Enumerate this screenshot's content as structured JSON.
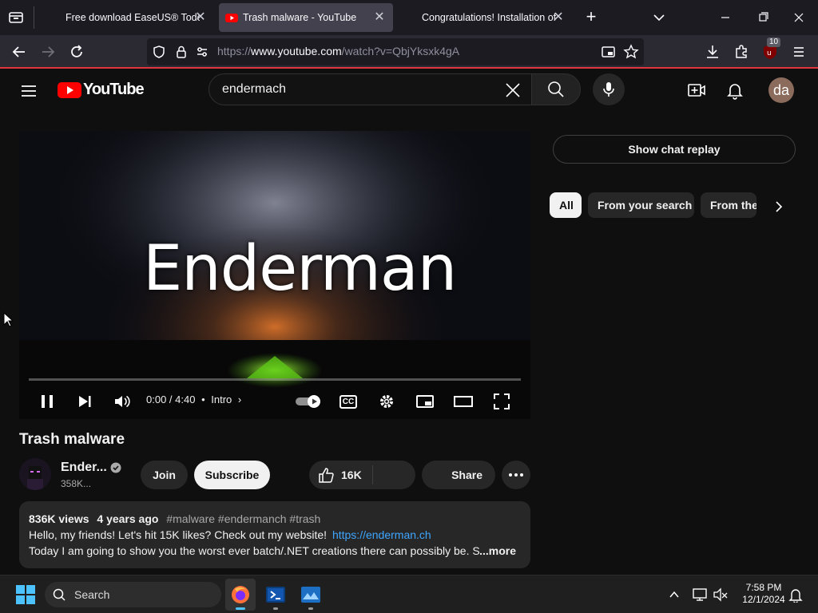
{
  "browser": {
    "tabs": [
      {
        "title": "Free download EaseUS® Todo Ba",
        "active": false
      },
      {
        "title": "Trash malware - YouTube",
        "active": true
      },
      {
        "title": "Congratulations! Installation of",
        "active": false
      }
    ],
    "new_tab_label": "+",
    "url_prefix": "https://",
    "url_host": "www.youtube.com",
    "url_path": "/watch?v=QbjYksxk4gA",
    "extension_badge": "10"
  },
  "youtube": {
    "logo_text": "YouTube",
    "search_value": "endermach",
    "avatar_initials": "da",
    "video": {
      "overlay_text": "Enderman",
      "time": "0:00 / 4:40",
      "chapter": "Intro",
      "cc_label": "CC",
      "progress": 0.0
    },
    "title": "Trash malware",
    "channel_name": "Ender...",
    "subscribers": "358K...",
    "join_label": "Join",
    "subscribe_label": "Subscribe",
    "likes": "16K",
    "share_label": "Share",
    "description": {
      "views": "836K views",
      "age": "4 years ago",
      "tags": "#malware #endermanch #trash",
      "line1": "Hello, my friends! Let's hit 15K likes? Check out my website!",
      "link": "https://enderman.ch",
      "line2": "Today I am going to show you the worst ever batch/.NET creations there can possibly be. S",
      "more": "...more"
    },
    "chat_replay_label": "Show chat replay",
    "chips": [
      "All",
      "From your search",
      "From the"
    ]
  },
  "taskbar": {
    "search_placeholder": "Search",
    "time": "7:58 PM",
    "date": "12/1/2024"
  },
  "colors": {
    "accent": "#ff0000",
    "link": "#3ea6ff",
    "firefox_accent": "#e0353d"
  }
}
